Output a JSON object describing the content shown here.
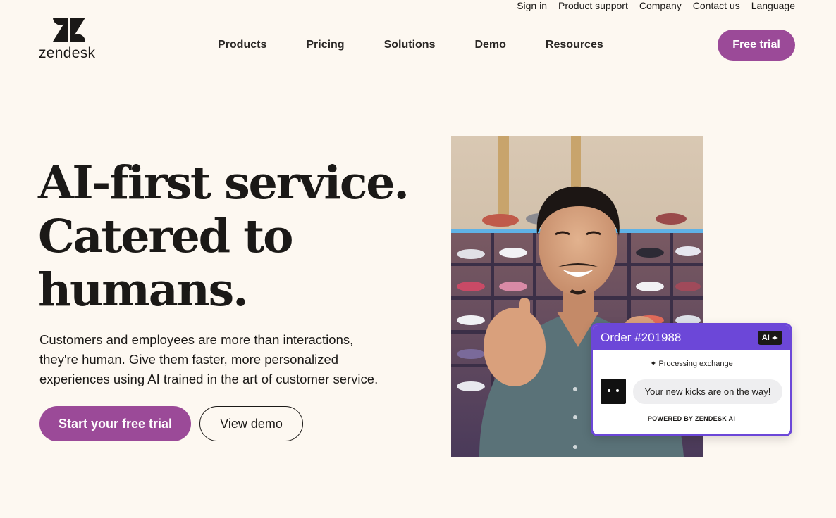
{
  "utility_nav": [
    "Sign in",
    "Product support",
    "Company",
    "Contact us",
    "Language"
  ],
  "logo": {
    "wordmark": "zendesk"
  },
  "main_nav": [
    "Products",
    "Pricing",
    "Solutions",
    "Demo",
    "Resources"
  ],
  "header": {
    "free_trial_label": "Free trial"
  },
  "hero": {
    "title_lines": [
      "AI-first service.",
      "Catered to",
      "humans."
    ],
    "subtitle_lines": [
      "Customers and employees are more than interactions,",
      "they're human. Give them faster, more personalized",
      "experiences using AI trained in the art of customer service."
    ],
    "primary_cta": "Start your free trial",
    "secondary_cta": "View demo"
  },
  "order_card": {
    "title": "Order #201988",
    "badge": "AI",
    "status": "Processing exchange",
    "message": "Your new kicks are on the way!",
    "footer": "POWERED BY ZENDESK AI"
  },
  "colors": {
    "background": "#fdf8f1",
    "brand_purple": "#9b4a98",
    "card_purple": "#6c47d8",
    "text": "#1b1917"
  },
  "icons": [
    "zendesk-logo-icon",
    "sparkle-icon",
    "bot-avatar-icon"
  ]
}
